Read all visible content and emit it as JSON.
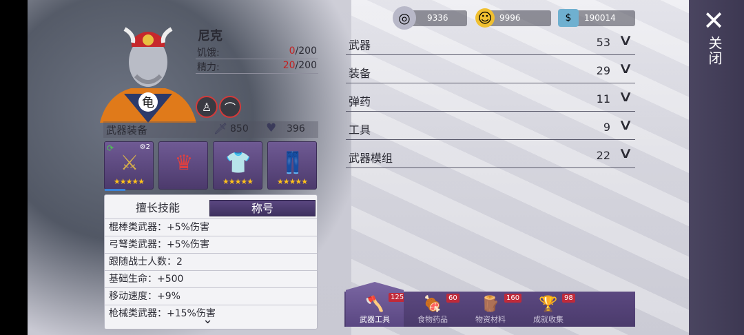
{
  "character": {
    "name": "尼克",
    "hunger_label": "饥饿:",
    "hunger_current": "0",
    "hunger_max": "/200",
    "energy_label": "精力:",
    "energy_current": "20",
    "energy_max": "/200"
  },
  "equipment": {
    "title": "武器装备",
    "attack": "850",
    "health": "396",
    "slots": [
      {
        "name": "weapon-slot",
        "level": "2",
        "stars": "★★★★★"
      },
      {
        "name": "headwear-slot",
        "stars": ""
      },
      {
        "name": "top-slot",
        "stars": "★★★★★"
      },
      {
        "name": "pants-slot",
        "stars": "★★★★★"
      }
    ]
  },
  "skills": {
    "tab_skills": "擅长技能",
    "tab_title": "称号",
    "rows": [
      "棍棒类武器：+5%伤害",
      "弓弩类武器：+5%伤害",
      "跟随战士人数：2",
      "基础生命：+500",
      "移动速度：+9%",
      "枪械类武器：+15%伤害"
    ]
  },
  "currencies": [
    {
      "icon": "silver-coin-icon",
      "value": "9336"
    },
    {
      "icon": "gold-coin-icon",
      "value": "9996"
    },
    {
      "icon": "cash-icon",
      "value": "190014"
    }
  ],
  "inventory": [
    {
      "label": "武器",
      "count": "53"
    },
    {
      "label": "装备",
      "count": "29"
    },
    {
      "label": "弹药",
      "count": "11"
    },
    {
      "label": "工具",
      "count": "9"
    },
    {
      "label": "武器模组",
      "count": "22"
    }
  ],
  "bottom_tabs": [
    {
      "label": "武器工具",
      "count": "125",
      "icon": "axe-icon",
      "active": true
    },
    {
      "label": "食物药品",
      "count": "60",
      "icon": "meat-icon",
      "active": false
    },
    {
      "label": "物资材料",
      "count": "160",
      "icon": "log-icon",
      "active": false
    },
    {
      "label": "成就收集",
      "count": "98",
      "icon": "trophy-icon",
      "active": false
    }
  ],
  "close_label": "关闭",
  "colors": {
    "accent_purple": "#4b3b6c",
    "alert_red": "#c42020",
    "star_gold": "#ffc21a"
  }
}
